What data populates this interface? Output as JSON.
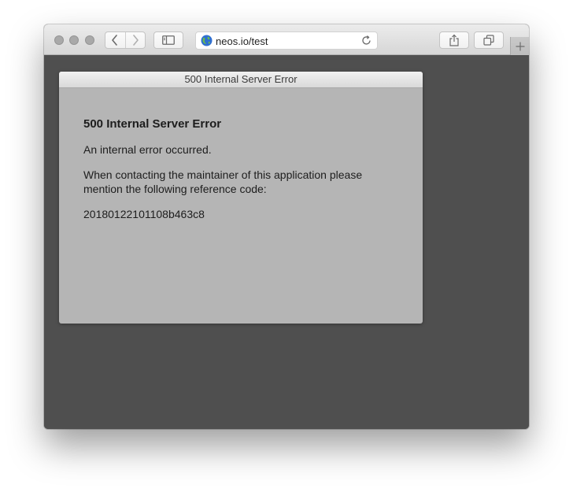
{
  "browser": {
    "url": "neos.io/test",
    "icons": {
      "back": "chevron-left-icon",
      "forward": "chevron-right-icon",
      "sidebar": "sidebar-icon",
      "site": "globe-icon",
      "reload": "reload-icon",
      "share": "share-icon",
      "tabs": "tabs-overview-icon",
      "new_tab": "plus-icon"
    }
  },
  "dialog": {
    "title": "500 Internal Server Error",
    "heading": "500 Internal Server Error",
    "message": "An internal error occurred.",
    "instruction": "When contacting the maintainer of this application please mention the following reference code:",
    "reference_code": "20180122101108b463c8"
  },
  "colors": {
    "page_background": "#4f4f4f",
    "dialog_background": "#b5b5b5"
  }
}
